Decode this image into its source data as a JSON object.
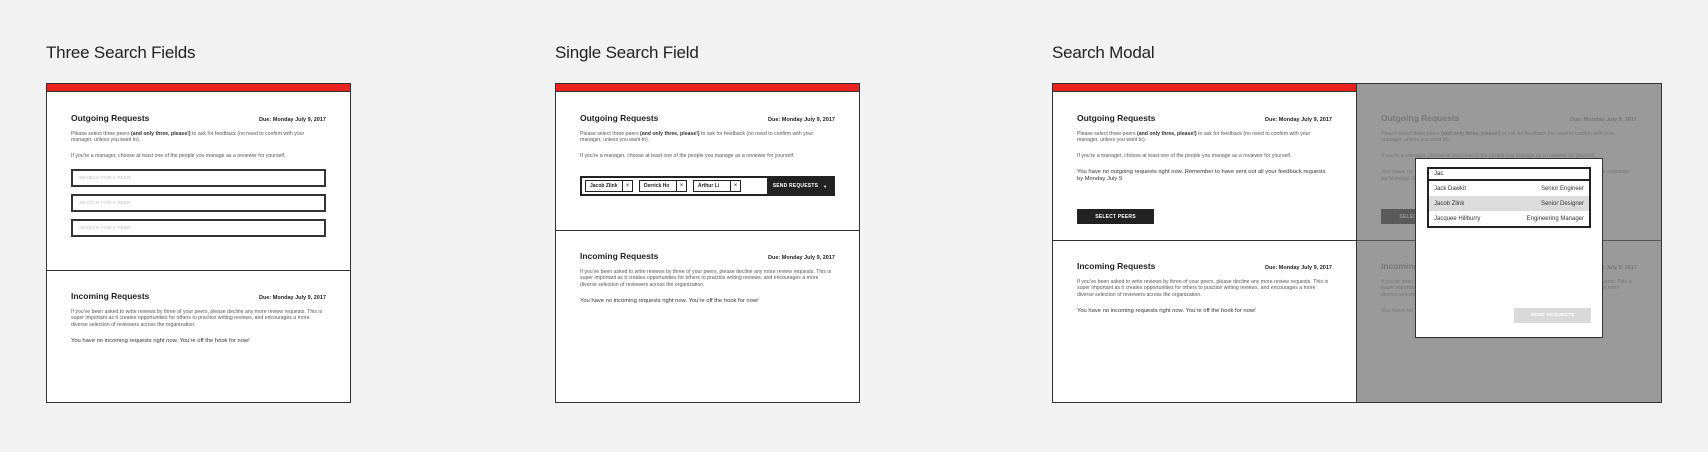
{
  "columns": [
    {
      "title": "Three Search Fields"
    },
    {
      "title": "Single Search Field"
    },
    {
      "title": "Search Modal"
    }
  ],
  "outgoing": {
    "title": "Outgoing Requests",
    "due": "Due: Monday July 9, 2017",
    "intro_pre": "Please select three peers ",
    "intro_bold": "(and only three, please!)",
    "intro_post": " to ask for feedback (no need to confirm with your manager, unless you want to).",
    "manager_note": "If you're a manager, choose at least one of the people you manage as a reviewer for yourself.",
    "empty_message": "You have no outgoing requests right now. Remember to have sent out all your feedback requests by Monday July 9",
    "select_peers_button": "SELECT PEERS",
    "search_placeholder": "SEARCH FOR A PEER"
  },
  "incoming": {
    "title": "Incoming Requests",
    "due": "Due: Monday July 9, 2017",
    "description": "If you've been asked to write reviews by three of your peers, please decline any more review requests. This is super important as it creates opportunities for others to practice writing reviews, and encourages a more diverse selection of reviewers across the organization.",
    "empty_message": "You have no incoming requests right now. You're off the hook for now!"
  },
  "chips": [
    {
      "label": "Jacob Zlink",
      "remove": "×"
    },
    {
      "label": "Derrick Ho",
      "remove": "×"
    },
    {
      "label": "Arthur Li",
      "remove": "×"
    }
  ],
  "send_requests": "SEND REQUESTS",
  "caret": "▼",
  "modal": {
    "query": "Jac",
    "results": [
      {
        "name": "Jack Dawkit",
        "role": "Senior Engineer"
      },
      {
        "name": "Jacob Zlink",
        "role": "Senior Designer"
      },
      {
        "name": "Jacquee Hillburry",
        "role": "Engineering Manager"
      }
    ],
    "send_button": "SEND REQUESTS"
  },
  "colors": {
    "accent_red": "#e8231f",
    "dark": "#222222",
    "overlay": "#9a9a9a"
  }
}
